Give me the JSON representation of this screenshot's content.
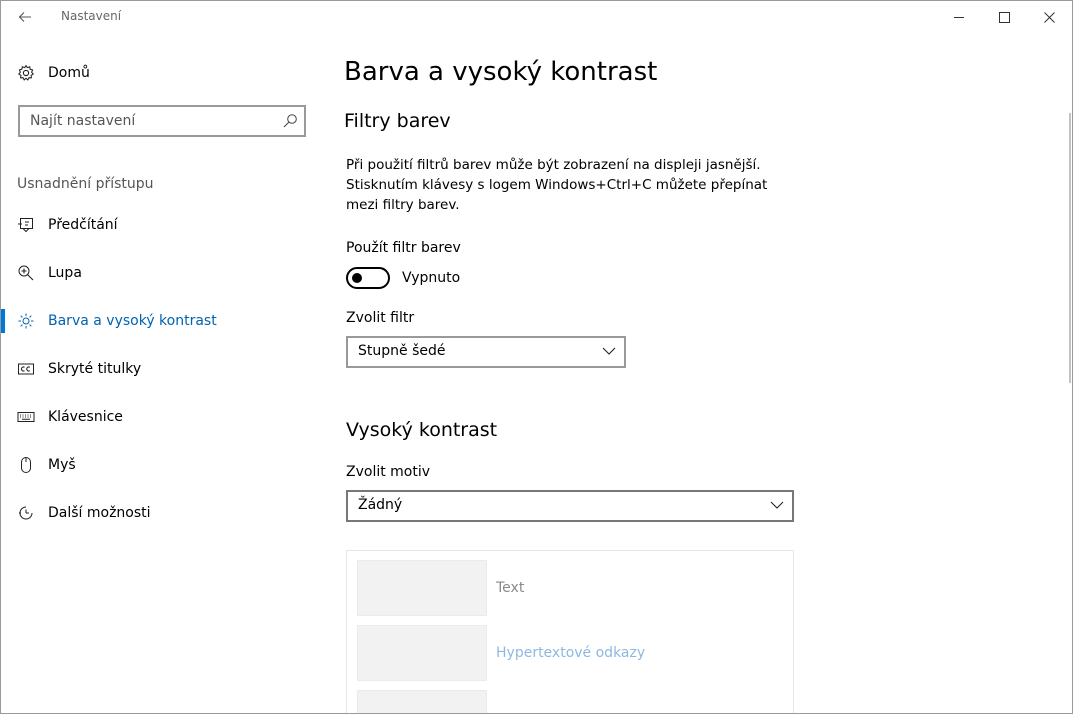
{
  "window": {
    "title": "Nastavení"
  },
  "sidebar": {
    "home_label": "Domů",
    "search_placeholder": "Najít nastavení",
    "section_label": "Usnadnění přístupu",
    "items": [
      {
        "label": "Předčítání",
        "icon": "narrator-icon"
      },
      {
        "label": "Lupa",
        "icon": "magnifier-icon"
      },
      {
        "label": "Barva a vysoký kontrast",
        "icon": "brightness-icon",
        "active": true
      },
      {
        "label": "Skryté titulky",
        "icon": "closed-captions-icon"
      },
      {
        "label": "Klávesnice",
        "icon": "keyboard-icon"
      },
      {
        "label": "Myš",
        "icon": "mouse-icon"
      },
      {
        "label": "Další možnosti",
        "icon": "more-options-icon"
      }
    ]
  },
  "main": {
    "page_title": "Barva a vysoký kontrast",
    "filters": {
      "heading": "Filtry barev",
      "description": "Při použití filtrů barev může být zobrazení na displeji jasnější. Stisknutím klávesy s logem Windows+Ctrl+C můžete přepínat mezi filtry barev.",
      "toggle_label": "Použít filtr barev",
      "toggle_state": "Vypnuto",
      "select_label": "Zvolit filtr",
      "select_value": "Stupně šedé"
    },
    "contrast": {
      "heading": "Vysoký kontrast",
      "select_label": "Zvolit motiv",
      "select_value": "Žádný",
      "preview": [
        {
          "label": "Text",
          "color": "#8a8a8a"
        },
        {
          "label": "Hypertextové odkazy",
          "color": "#8fb8e0"
        }
      ]
    }
  },
  "colors": {
    "accent": "#0078d7",
    "active_text": "#0063b1"
  }
}
